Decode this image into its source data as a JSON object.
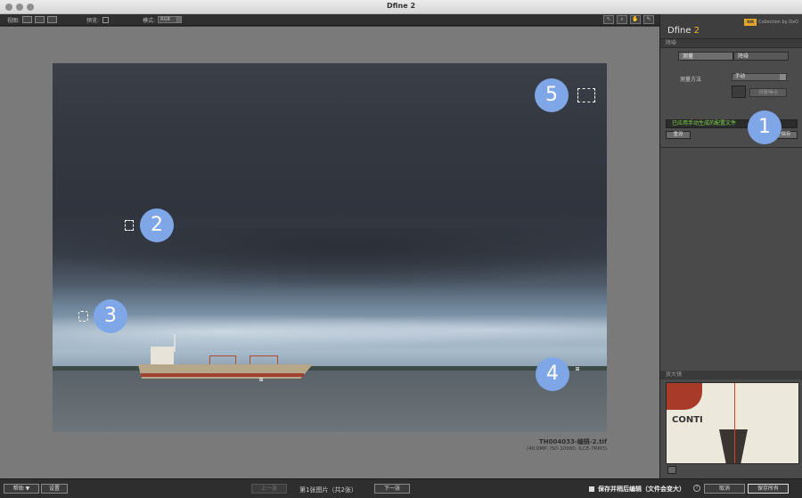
{
  "window": {
    "title": "Dfine 2"
  },
  "toolbar": {
    "view_label": "视图:",
    "preview_label": "预览:",
    "mode_label": "模式:",
    "mode_value": "RGB"
  },
  "panel": {
    "app_name": "Dfine",
    "app_version": "2",
    "brand_logo": "NIK",
    "brand_text": "Collection by DxO",
    "section_denoise": "降噪",
    "tab_measure": "测量",
    "tab_reduce": "降噪",
    "method_label": "测量方法",
    "method_value": "手动",
    "measure_noise_button": "测量噪点",
    "status_text": "已应用手动生成的配置文件",
    "reset_button": "重设",
    "save_button": "保存",
    "loupe_title": "放大镜",
    "loupe_text": "CONTI"
  },
  "image": {
    "filename": "TH004033-编辑-2.tif",
    "meta": "(40.6MP, ISO 10000, ILCE-7RM3)"
  },
  "markers": [
    "1",
    "2",
    "3",
    "4",
    "5"
  ],
  "bottom": {
    "help_button": "帮助 ▼",
    "settings_button": "设置",
    "prev_button": "上一张",
    "page_text": "第1张图片（共2张）",
    "next_button": "下一张",
    "save_edit_label": "保存并稍后编辑（文件会变大）",
    "info_icon": "?",
    "cancel_button": "取消",
    "save_all_button": "保存所有"
  },
  "colors": {
    "accent_version": "#f2b432",
    "marker": "#7fa6e6",
    "status_text": "#7fd64a"
  }
}
